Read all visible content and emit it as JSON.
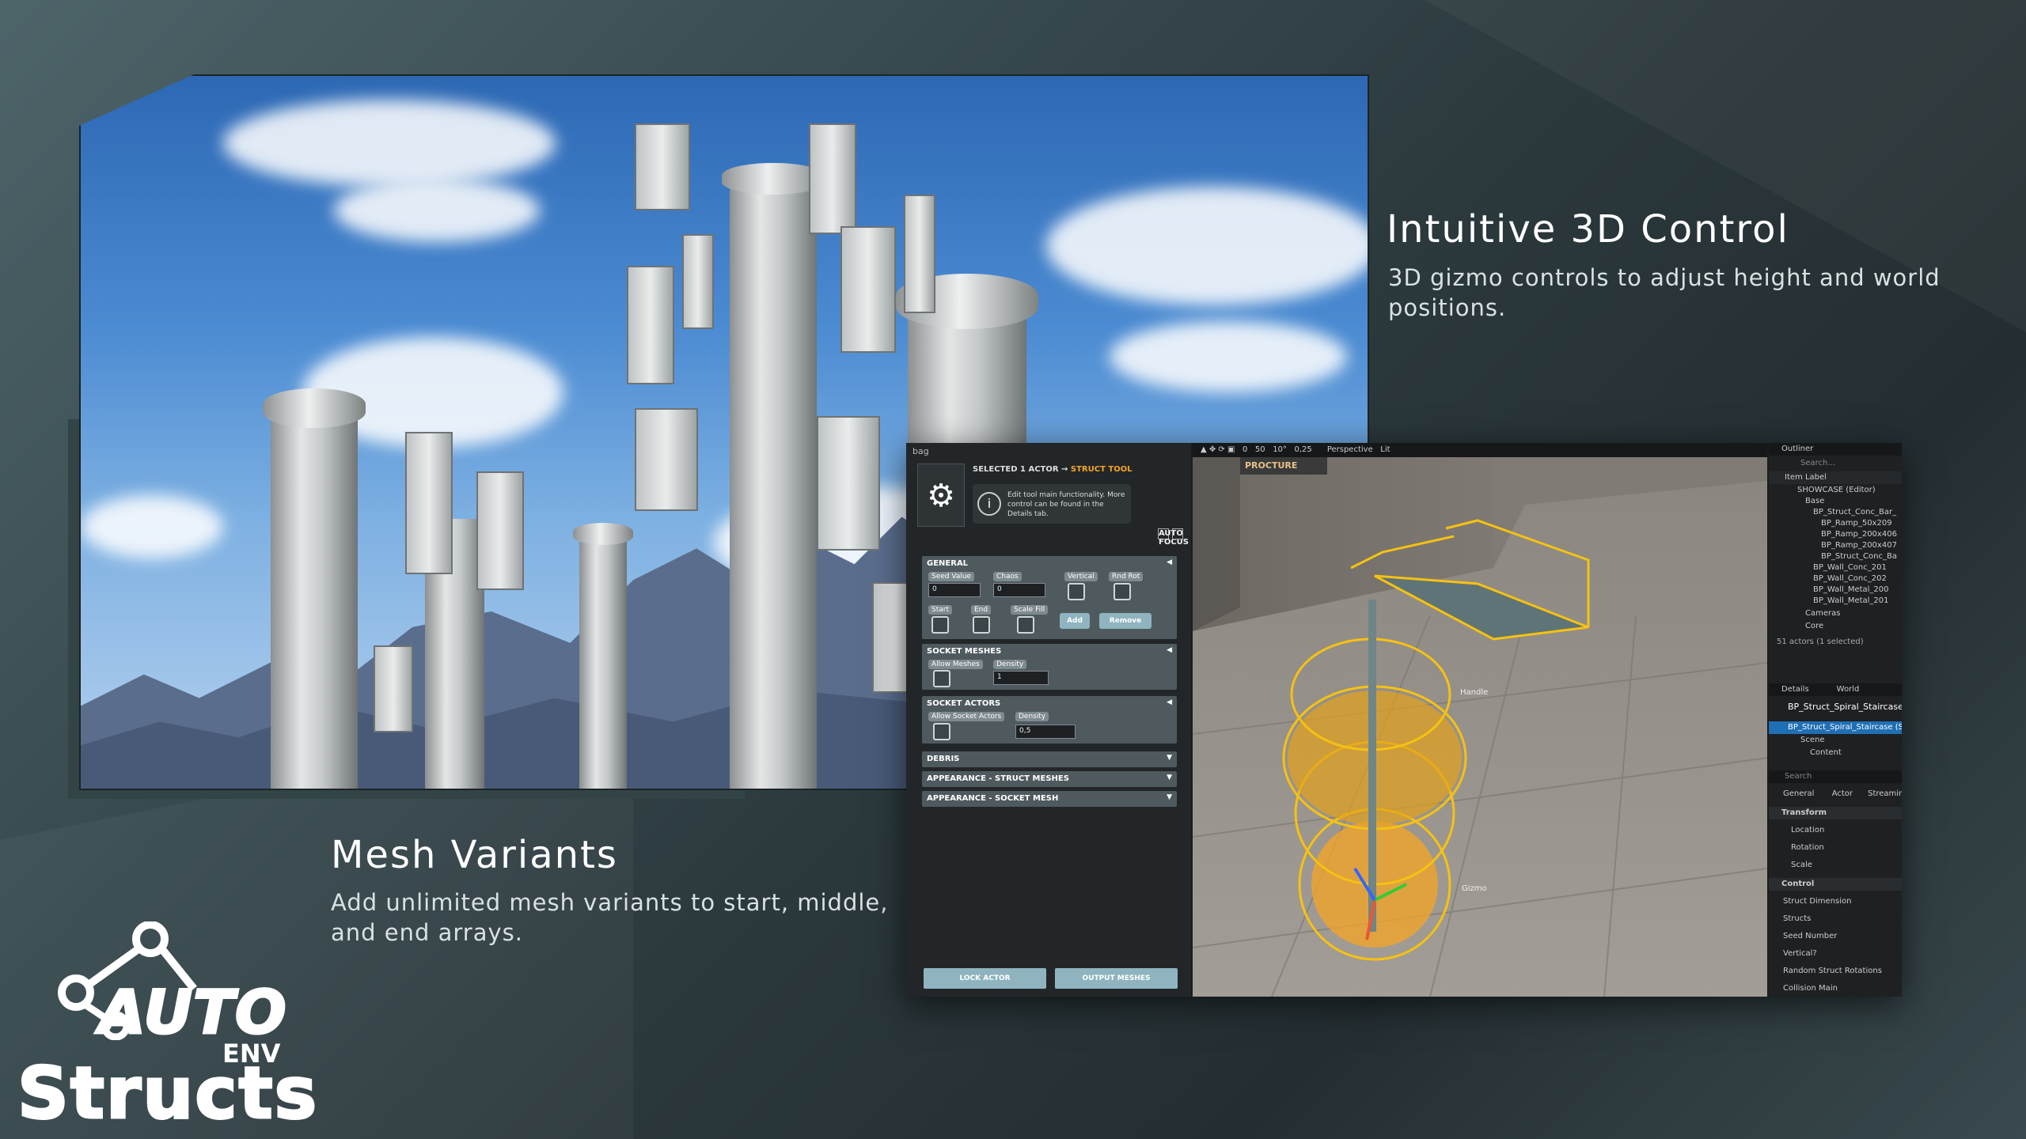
{
  "heading_right": {
    "title": "Intuitive 3D Control",
    "desc_line1": "3D gizmo controls to adjust height and world",
    "desc_line2": "positions."
  },
  "heading_left": {
    "title": "Mesh Variants",
    "desc_line1": "Add unlimited mesh variants to start, middle,",
    "desc_line2": "and end arrays."
  },
  "logo": {
    "auto": "AUTO",
    "env": "ENV",
    "structs": "Structs"
  },
  "tool_panel": {
    "tab": "bag",
    "selected_prefix": "SELECTED 1 ACTOR →",
    "selected_tool": "STRUCT TOOL",
    "info_text": "Edit tool main functionality. More control can be found in the Details tab.",
    "auto_focus": "AUTO FOCUS",
    "general": {
      "header": "GENERAL",
      "seed_value_label": "Seed Value",
      "seed_value": "0",
      "chaos_label": "Chaos",
      "chaos": "0",
      "vertical_label": "Vertical",
      "rnd_rot_label": "Rnd Rot",
      "start_label": "Start",
      "end_label": "End",
      "scale_fill_label": "Scale Fill",
      "add_label": "Add",
      "remove_label": "Remove"
    },
    "socket_meshes": {
      "header": "SOCKET MESHES",
      "allow_label": "Allow Meshes",
      "density_label": "Density",
      "density": "1"
    },
    "socket_actors": {
      "header": "SOCKET ACTORS",
      "allow_label": "Allow Socket Actors",
      "density_label": "Density",
      "density": "0,5"
    },
    "collapsed": [
      "DEBRIS",
      "APPEARANCE - STRUCT MESHES",
      "APPEARANCE - SOCKET MESH"
    ],
    "lock_actor": "LOCK ACTOR",
    "output_meshes": "OUTPUT MESHES"
  },
  "viewport": {
    "toolbar": [
      "0",
      "50",
      "10°",
      "0,25",
      "Perspective",
      "Lit"
    ],
    "handle_label": "Handle",
    "gizmo_label": "Gizmo",
    "sign_text": "PROCTURE"
  },
  "outliner": {
    "title": "Outliner",
    "search_placeholder": "Search...",
    "column": "Item Label",
    "rows": [
      "SHOWCASE (Editor)",
      "Base",
      "BP_Struct_Conc_Bar_",
      "BP_Ramp_50x209",
      "BP_Ramp_200x406",
      "BP_Ramp_200x407",
      "BP_Struct_Conc_Ba",
      "BP_Wall_Conc_201",
      "BP_Wall_Conc_202",
      "BP_Wall_Metal_200",
      "BP_Wall_Metal_201",
      "Cameras",
      "Core"
    ],
    "count": "51 actors (1 selected)"
  },
  "details": {
    "tab": "Details",
    "tab2": "World",
    "actor": "BP_Struct_Spiral_Staircase",
    "selected": "BP_Struct_Spiral_Staircase (Sel",
    "scene": "Scene",
    "content": "Content",
    "search_placeholder": "Search",
    "filters": [
      "General",
      "Actor",
      "Streaming"
    ],
    "transform": "Transform",
    "location": "Location",
    "rotation": "Rotation",
    "scale": "Scale",
    "control": "Control",
    "props": [
      "Struct Dimension",
      "Structs",
      "Seed Number",
      "Vertical?",
      "Random Struct Rotations",
      "Collision Main"
    ]
  },
  "colors": {
    "accent": "#f5a623",
    "button": "#8fb4bf",
    "panel": "#232628"
  }
}
